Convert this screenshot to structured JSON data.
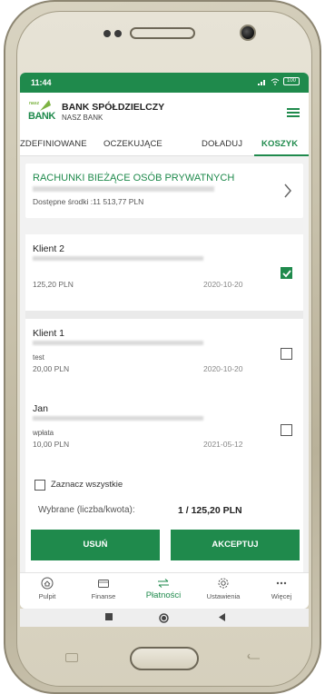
{
  "status_bar": {
    "time": "11:44",
    "battery": "100"
  },
  "header": {
    "logo_small": "nasz",
    "logo_bank": "BANK",
    "bank_name": "BANK SPÓŁDZIELCZY",
    "bank_sub": "NASZ BANK"
  },
  "tabs": [
    {
      "label": "ZDEFINIOWANE",
      "active": false
    },
    {
      "label": "OCZEKUJĄCE",
      "active": false
    },
    {
      "label": "DOŁADUJ",
      "active": false
    },
    {
      "label": "KOSZYK",
      "active": true
    }
  ],
  "account": {
    "title": "RACHUNKI BIEŻĄCE OSÓB PRYWATNYCH",
    "balance": "Dostępne środki :11 513,77 PLN"
  },
  "items": [
    {
      "name": "Klient 2",
      "title": "",
      "amount": "125,20 PLN",
      "date": "2020-10-20",
      "checked": true
    },
    {
      "name": "Klient 1",
      "title": "test",
      "amount": "20,00 PLN",
      "date": "2020-10-20",
      "checked": false
    },
    {
      "name": "Jan",
      "title": "wpłata",
      "amount": "10,00 PLN",
      "date": "2021-05-12",
      "checked": false
    }
  ],
  "footer": {
    "select_all": "Zaznacz wszystkie",
    "summary_label": "Wybrane (liczba/kwota):",
    "summary_value": "1 / 125,20 PLN",
    "delete_label": "USUŃ",
    "accept_label": "AKCEPTUJ"
  },
  "bottom_nav": [
    {
      "label": "Pulpit",
      "icon": "home-icon",
      "active": false
    },
    {
      "label": "Finanse",
      "icon": "wallet-icon",
      "active": false
    },
    {
      "label": "Płatności",
      "icon": "transfer-arrows-icon",
      "active": true
    },
    {
      "label": "Ustawienia",
      "icon": "gear-icon",
      "active": false
    },
    {
      "label": "Więcej",
      "icon": "more-dots-icon",
      "active": false
    }
  ],
  "colors": {
    "brand_green": "#1f8a4c",
    "accent_light_green": "#7cb342"
  }
}
